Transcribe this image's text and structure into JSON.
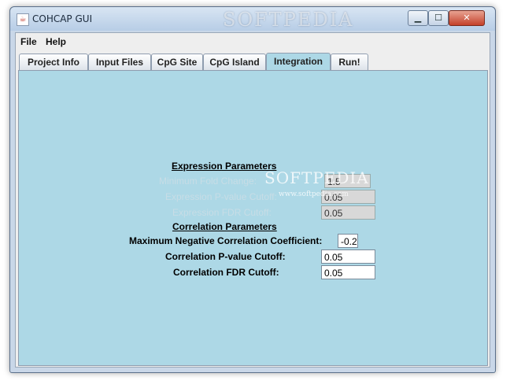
{
  "window": {
    "title": "COHCAP GUI",
    "app_icon": "java-icon",
    "watermark": "SOFTPEDIA",
    "controls": {
      "minimize": "▁",
      "maximize": "☐",
      "close": "✕"
    }
  },
  "menu": [
    "File",
    "Help"
  ],
  "tabs": [
    "Project Info",
    "Input Files",
    "CpG Site",
    "CpG Island",
    "Integration",
    "Run!"
  ],
  "active_tab": "Integration",
  "expression": {
    "heading": "Expression Parameters",
    "fold_label": "Minimum Fold Change:",
    "fold_value": "1.5",
    "pval_label": "Expression P-value Cutoff:",
    "pval_value": "0.05",
    "fdr_label": "Expression FDR Cutoff:",
    "fdr_value": "0.05"
  },
  "correlation": {
    "heading": "Correlation Parameters",
    "neg_label": "Maximum Negative Correlation Coefficient:",
    "neg_value": "-0.2",
    "pval_label": "Correlation P-value Cutoff:",
    "pval_value": "0.05",
    "fdr_label": "Correlation FDR Cutoff:",
    "fdr_value": "0.05"
  },
  "overlay": {
    "logo": "SOFTPEDIA",
    "url": "www.softpedia.com"
  }
}
